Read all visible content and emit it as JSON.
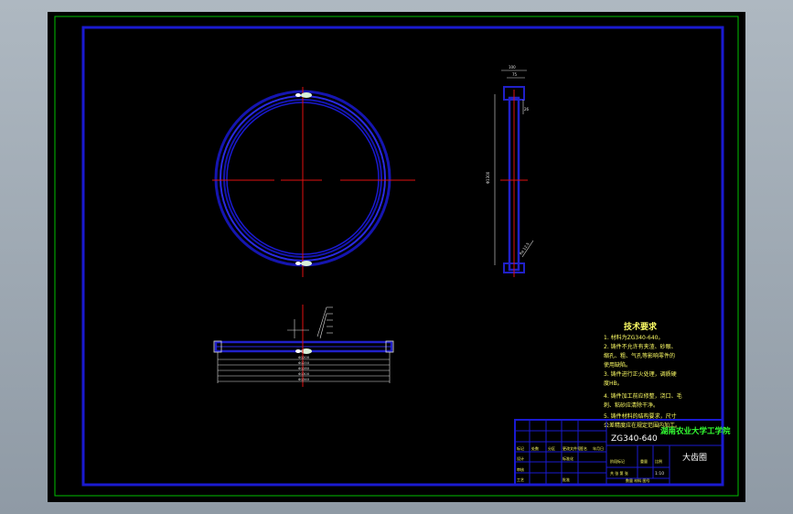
{
  "viewer": {
    "background": "#9aa5af",
    "canvas_color": "#000000"
  },
  "colors": {
    "outer_frame": "#00c000",
    "inner_frame": "#1a1ad0",
    "part_outline": "#2020c8",
    "centerline": "#e01010",
    "dimension": "#e0e0e0",
    "text_yellow": "#ffff66",
    "text_green": "#44ff44",
    "title_green": "#33ff33"
  },
  "technical_requirements": {
    "heading": "技术要求",
    "lines": [
      "1. 材料为ZG340-640。",
      "2. 铸件不允许有夹渣、砂眼、",
      "缩孔、粗、气孔等影响零件的",
      "使用缺陷。",
      "3. 铸件进行正火处理，调质硬",
      "度HB。",
      "4. 铸件加工前应修整，浇口、毛",
      "刺、粘砂应清除干净。",
      "5. 铸件材料的结构要求，尺寸",
      "公差精度应在规定范围内加工。"
    ]
  },
  "title_block": {
    "material": "ZG340-640",
    "school": "湖南农业大学工学院",
    "drawing_name": "大齿圈",
    "scale": "1:10",
    "cells": [
      "标记",
      "处数",
      "分区",
      "更改文件号",
      "签名",
      "年月日",
      "设计",
      "标准化",
      "审核",
      "工艺",
      "批准",
      "阶段标记",
      "重量",
      "比例",
      "共 张 第 张"
    ],
    "footer": "数量 材料 图号"
  },
  "dimensions": {
    "side_top": [
      "100",
      "75"
    ],
    "side_right": "26",
    "side_height": "Φ1300",
    "side_note": "Ra 12.5",
    "bottom": [
      "Φ1200",
      "Φ1250",
      "Φ1280",
      "Φ1300",
      "Φ1340"
    ]
  }
}
